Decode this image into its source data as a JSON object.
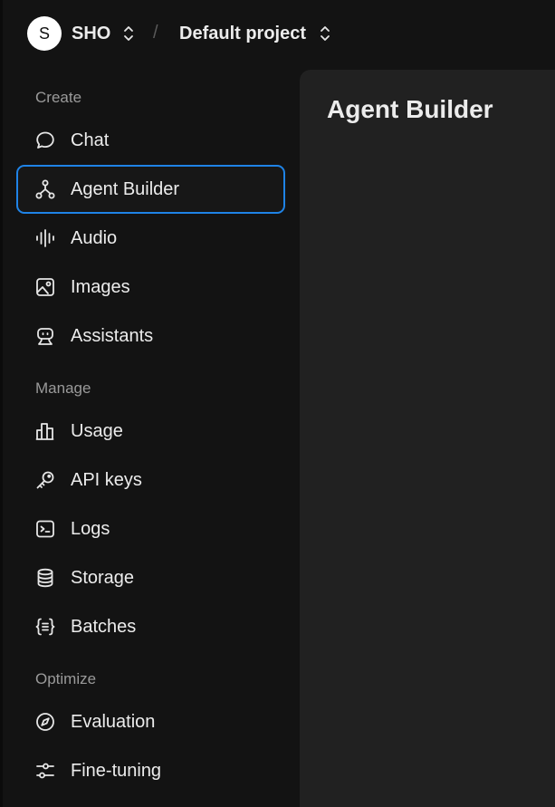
{
  "topbar": {
    "org_initial": "S",
    "org_name": "SHO",
    "separator": "/",
    "project_name": "Default project"
  },
  "sidebar": {
    "sections": [
      {
        "label": "Create"
      },
      {
        "label": "Manage"
      },
      {
        "label": "Optimize"
      }
    ],
    "items": [
      {
        "label": "Chat",
        "icon": "chat-bubble-icon"
      },
      {
        "label": "Agent Builder",
        "icon": "agent-builder-icon",
        "active": true
      },
      {
        "label": "Audio",
        "icon": "audio-waveform-icon"
      },
      {
        "label": "Images",
        "icon": "image-icon"
      },
      {
        "label": "Assistants",
        "icon": "robot-icon"
      },
      {
        "label": "Usage",
        "icon": "bar-chart-icon"
      },
      {
        "label": "API keys",
        "icon": "key-icon"
      },
      {
        "label": "Logs",
        "icon": "terminal-icon"
      },
      {
        "label": "Storage",
        "icon": "database-icon"
      },
      {
        "label": "Batches",
        "icon": "braces-list-icon"
      },
      {
        "label": "Evaluation",
        "icon": "compass-icon"
      },
      {
        "label": "Fine-tuning",
        "icon": "sliders-icon"
      }
    ]
  },
  "main": {
    "title": "Agent Builder"
  },
  "colors": {
    "background": "#131313",
    "panel": "#212121",
    "accent": "#1f83e6"
  }
}
